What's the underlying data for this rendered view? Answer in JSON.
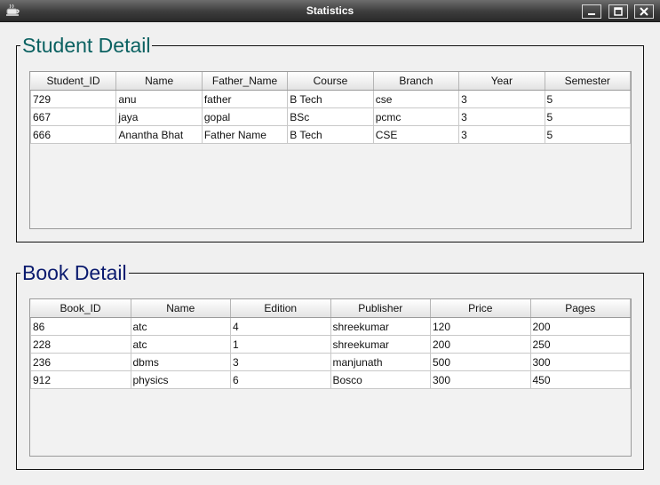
{
  "window": {
    "title": "Statistics",
    "min_label": "_",
    "max_label": "",
    "close_label": ""
  },
  "student": {
    "heading": "Student Detail",
    "columns": [
      "Student_ID",
      "Name",
      "Father_Name",
      "Course",
      "Branch",
      "Year",
      "Semester"
    ],
    "rows": [
      [
        "729",
        "anu",
        "father",
        "B Tech",
        "cse",
        "3",
        "5"
      ],
      [
        "667",
        "jaya",
        "gopal",
        "BSc",
        "pcmc",
        "3",
        "5"
      ],
      [
        "666",
        "Anantha Bhat",
        "Father Name",
        "B Tech",
        "CSE",
        "3",
        "5"
      ]
    ]
  },
  "book": {
    "heading": "Book Detail",
    "columns": [
      "Book_ID",
      "Name",
      "Edition",
      "Publisher",
      "Price",
      "Pages"
    ],
    "rows": [
      [
        "86",
        "atc",
        "4",
        "shreekumar",
        "120",
        "200"
      ],
      [
        "228",
        "atc",
        "1",
        "shreekumar",
        "200",
        "250"
      ],
      [
        "236",
        "dbms",
        "3",
        "manjunath",
        "500",
        "300"
      ],
      [
        "912",
        "physics",
        "6",
        "Bosco",
        "300",
        "450"
      ]
    ]
  },
  "colors": {
    "student_heading": "#0a6161",
    "book_heading": "#0a1a6e",
    "titlebar": "#3c3c3c"
  },
  "icons": {
    "app": "coffee-cup-icon",
    "minimize": "minimize-icon",
    "maximize": "maximize-icon",
    "close": "close-icon"
  }
}
